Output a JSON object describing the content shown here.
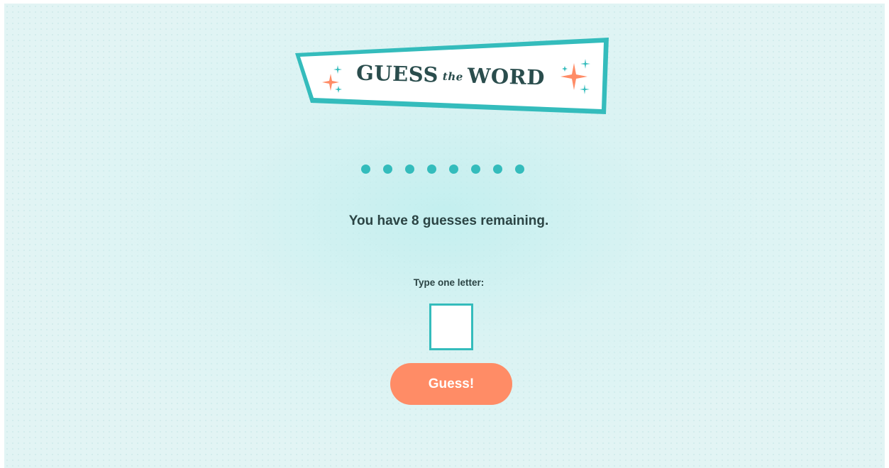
{
  "logo": {
    "part1": "GUESS",
    "part2": "the",
    "part3": "WORD"
  },
  "word_progress": {
    "letters": [
      "●",
      "●",
      "●",
      "●",
      "●",
      "●",
      "●",
      "●"
    ]
  },
  "status": {
    "remaining_text": "You have 8 guesses remaining."
  },
  "form": {
    "label": "Type one letter:",
    "input_value": "",
    "button_label": "Guess!"
  },
  "colors": {
    "background": "#e2f4f4",
    "accent": "#34bcbc",
    "button": "#ff8c66",
    "text": "#2b4444",
    "sparkle_teal": "#34bcbc",
    "sparkle_coral": "#ff8c66"
  }
}
